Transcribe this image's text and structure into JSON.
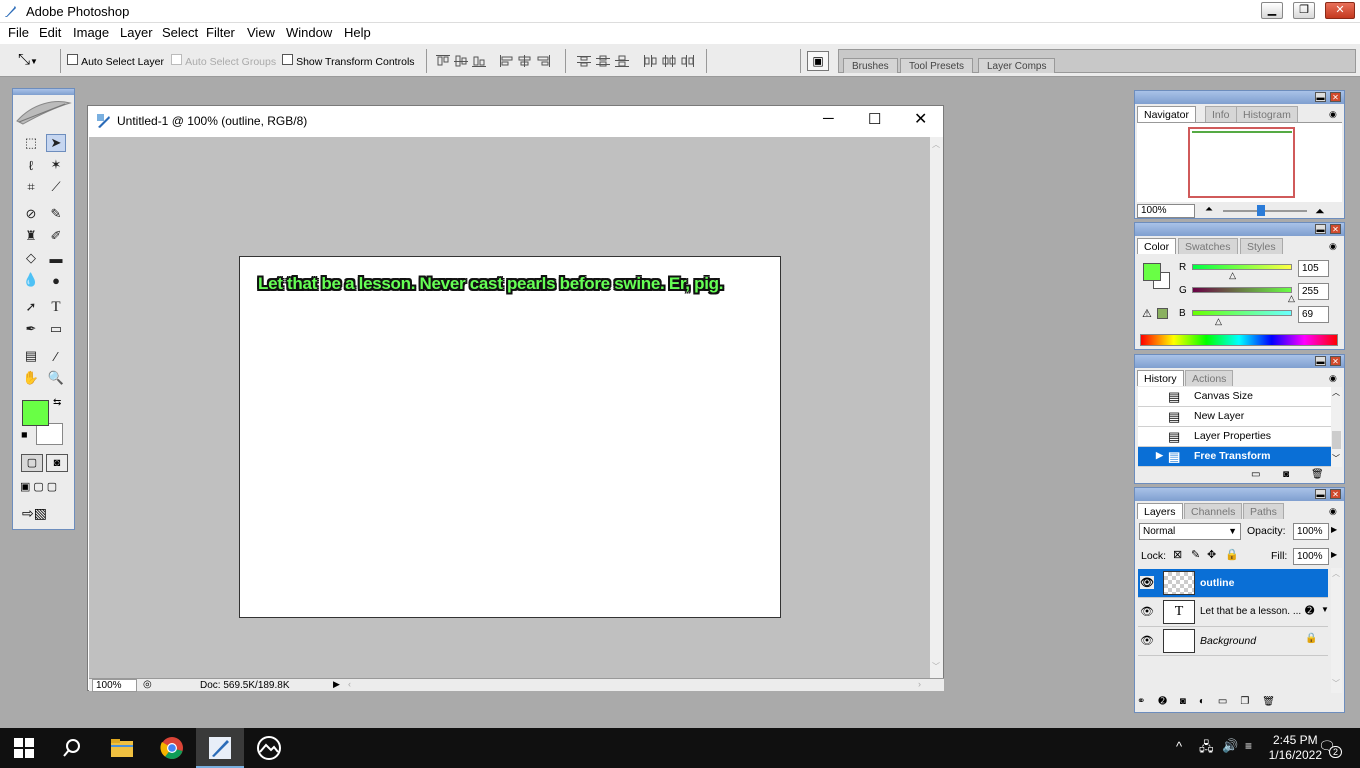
{
  "app": {
    "title": "Adobe Photoshop"
  },
  "menu": [
    "File",
    "Edit",
    "Image",
    "Layer",
    "Select",
    "Filter",
    "View",
    "Window",
    "Help"
  ],
  "options": {
    "auto_select_layer": "Auto Select Layer",
    "auto_select_groups": "Auto Select Groups",
    "show_transform_controls": "Show Transform Controls"
  },
  "palette_well": {
    "tabs": [
      "Brushes",
      "Tool Presets",
      "Layer Comps"
    ]
  },
  "document": {
    "title": "Untitled-1 @ 100% (outline, RGB/8)",
    "canvas_text": "Let that be a lesson. Never cast pearls before swine. Er, pig.",
    "zoom": "100%",
    "doc_info": "Doc: 569.5K/189.8K"
  },
  "navigator": {
    "tabs": [
      "Navigator",
      "Info",
      "Histogram"
    ],
    "zoom": "100%"
  },
  "color": {
    "tabs": [
      "Color",
      "Swatches",
      "Styles"
    ],
    "r_label": "R",
    "g_label": "G",
    "b_label": "B",
    "r": "105",
    "g": "255",
    "b": "69",
    "foreground": "#69ff45"
  },
  "history": {
    "tabs": [
      "History",
      "Actions"
    ],
    "items": [
      "Canvas Size",
      "New Layer",
      "Layer Properties",
      "Free Transform"
    ]
  },
  "layers": {
    "tabs": [
      "Layers",
      "Channels",
      "Paths"
    ],
    "blend_mode": "Normal",
    "opacity_label": "Opacity:",
    "opacity": "100%",
    "lock_label": "Lock:",
    "fill_label": "Fill:",
    "fill": "100%",
    "items": [
      "outline",
      "Let that be a lesson. ...",
      "Background"
    ]
  },
  "taskbar": {
    "time": "2:45 PM",
    "date": "1/16/2022",
    "notifications": "2"
  }
}
